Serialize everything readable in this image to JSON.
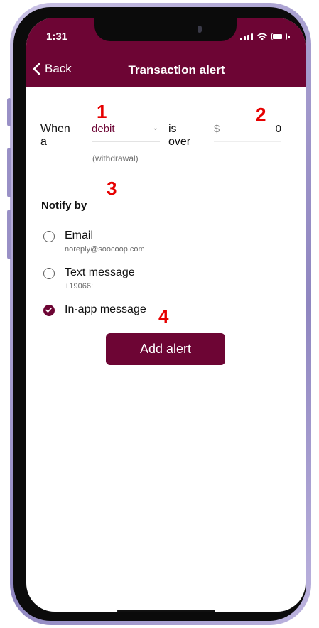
{
  "status_bar": {
    "time": "1:31"
  },
  "header": {
    "back_label": "Back",
    "title": "Transaction alert"
  },
  "condition": {
    "prefix": "When a",
    "type_value": "debit",
    "type_caption": "(withdrawal)",
    "middle": "is over",
    "currency_symbol": "$",
    "amount": "0"
  },
  "notify": {
    "heading": "Notify by",
    "options": [
      {
        "label": "Email",
        "detail": "noreply@soocoop.com",
        "selected": false
      },
      {
        "label": "Text message",
        "detail": "+19066:",
        "selected": false
      },
      {
        "label": "In-app message",
        "detail": "",
        "selected": true
      }
    ]
  },
  "actions": {
    "add_alert_label": "Add alert"
  },
  "callouts": [
    "1",
    "2",
    "3",
    "4"
  ],
  "colors": {
    "brand": "#6d0534",
    "callout": "#e60000"
  },
  "icons": [
    "signal-icon",
    "wifi-icon",
    "battery-icon",
    "chevron-left-icon",
    "chevron-down-icon",
    "checkmark-icon"
  ]
}
